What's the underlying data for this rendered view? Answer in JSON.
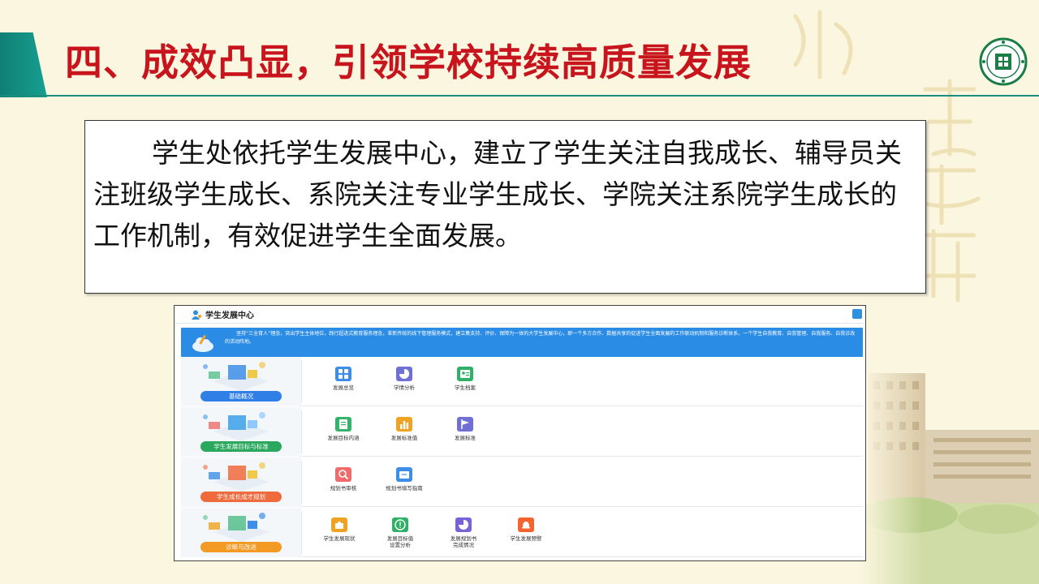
{
  "slide": {
    "title": "四、成效凸显，引领学校持续高质量发展",
    "body": "学生处依托学生发展中心，建立了学生关注自我成长、辅导员关注班级学生成长、系院关注专业学生成长、学院关注系院学生成长的工作机制，有效促进学生全面发展。"
  },
  "screenshot": {
    "title": "学生发展中心",
    "banner": "坚持“三全育人”理念，突出学生主体地位，践行超进式教育服务理念，革新传统的线下管理服务模式，建立集支持、评价、保障为一体的大学生发展中心，即一个多方合作、数据共享的促进学生全面发展的工作联动机制和服务诊断体系，一个学生自我教育、自我管理、自我服务、自我诊改的活动阵地。",
    "sections": [
      {
        "tag": "基础概况",
        "tag_color": "#2f7fe6",
        "apps": [
          {
            "label": "发展总览",
            "color": "#3d8ee8",
            "icon": "grid-icon"
          },
          {
            "label": "学情分析",
            "color": "#6f6fd6",
            "icon": "pie-icon"
          },
          {
            "label": "学生档案",
            "color": "#2fb067",
            "icon": "profile-icon"
          }
        ]
      },
      {
        "tag": "学生发展目标与标准",
        "tag_color": "#29a85e",
        "apps": [
          {
            "label": "发展目标内涵",
            "color": "#33b36b",
            "icon": "doc-icon"
          },
          {
            "label": "发展标准值",
            "color": "#f0a222",
            "icon": "bar-chart-icon"
          },
          {
            "label": "发展标准",
            "color": "#6f6fd6",
            "icon": "flag-icon"
          }
        ]
      },
      {
        "tag": "学生成长成才规划",
        "tag_color": "#ef6a3c",
        "apps": [
          {
            "label": "规划书审核",
            "color": "#f06b6b",
            "icon": "review-icon"
          },
          {
            "label": "规划书填写指南",
            "color": "#3d8ee8",
            "icon": "guide-icon"
          }
        ]
      },
      {
        "tag": "诊断与改进",
        "tag_color": "#f39a24",
        "apps": [
          {
            "label": "学生发展现状",
            "color": "#f0a222",
            "icon": "puzzle-icon"
          },
          {
            "label": "发展目标值\n设置分析",
            "color": "#2fb067",
            "icon": "alert-icon"
          },
          {
            "label": "发展规划书\n完成情况",
            "color": "#7a63d8",
            "icon": "pie-icon"
          },
          {
            "label": "学生发展预警",
            "color": "#f5642f",
            "icon": "bell-icon"
          }
        ]
      }
    ]
  }
}
